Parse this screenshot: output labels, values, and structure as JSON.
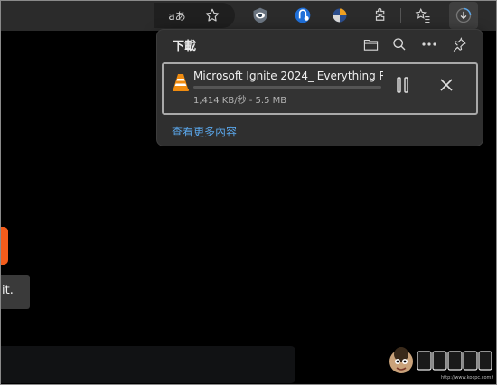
{
  "toolbar": {
    "icons": [
      "read-aloud-icon",
      "favorite-star-icon",
      "eye-extension-icon",
      "tracker-extension-icon",
      "color-extension-icon",
      "extensions-icon",
      "favorites-icon",
      "downloads-icon"
    ],
    "read_aloud_label": "aあ"
  },
  "downloads_panel": {
    "title": "下載",
    "item": {
      "filename": "Microsoft Ignite 2024_ Everything Re",
      "status": "1,414 KB/秒 - 5.5 MB",
      "progress": 0.0
    },
    "more_link": "查看更多內容"
  },
  "page": {
    "tooltip_text": "it."
  },
  "watermark": {
    "text": "電腦王阿達",
    "url": "http://www.kocpc.com.tw"
  },
  "colors": {
    "accent_link": "#5aa5e8",
    "orange": "#f35c1b",
    "panel_bg": "#2f2f2f"
  }
}
